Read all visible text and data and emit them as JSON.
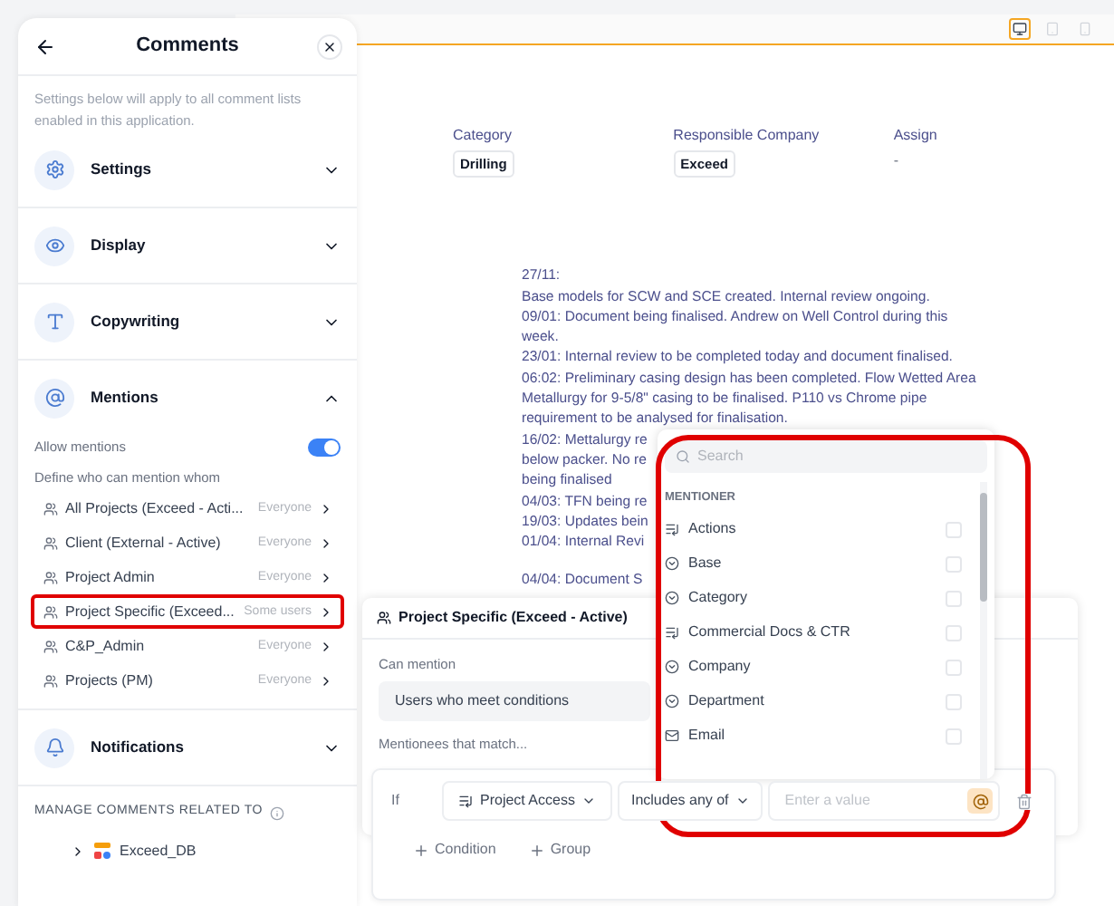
{
  "toolbar": {
    "devices": [
      {
        "kind": "desktop",
        "selected": true
      },
      {
        "kind": "tablet",
        "selected": false
      },
      {
        "kind": "phone",
        "selected": false
      }
    ]
  },
  "fields": [
    {
      "label": "Category",
      "value": "Drilling",
      "kind": "tag"
    },
    {
      "label": "Responsible Company",
      "value": "Exceed",
      "kind": "tag"
    },
    {
      "label": "Assign",
      "value": "-",
      "kind": "plain"
    }
  ],
  "notes": [
    "27/11:",
    "Base models for SCW and SCE created. Internal review ongoing.",
    "09/01: Document being finalised. Andrew on Well Control during this",
    "week.",
    "23/01: Internal review to be completed today and document finalised.",
    "06:02: Preliminary casing design has been completed. Flow Wetted Area",
    "Metallurgy for 9-5/8\" casing to be finalised. P110 vs Chrome pipe",
    "requirement to be analysed for finalisation.",
    "16/02: Mettalurgy re",
    "below packer. No re",
    "being finalised",
    "04/03: TFN being re",
    "19/03: Updates bein",
    "01/04: Internal Revi",
    "04/04: Document S"
  ],
  "comments_panel": {
    "title": "Comments",
    "description": "Settings below will apply to all comment lists enabled in this application.",
    "sections": [
      {
        "label": "Settings",
        "expanded": false
      },
      {
        "label": "Display",
        "expanded": false
      },
      {
        "label": "Copywriting",
        "expanded": false
      },
      {
        "label": "Mentions",
        "expanded": true
      },
      {
        "label": "Notifications",
        "expanded": false
      }
    ],
    "mentions": {
      "allow": {
        "label": "Allow mentions",
        "on": true
      },
      "define_label": "Define who can mention whom",
      "rules": [
        {
          "name": "All Projects (Exceed - Acti...",
          "who": "Everyone",
          "highlighted": false
        },
        {
          "name": "Client (External - Active)",
          "who": "Everyone",
          "highlighted": false
        },
        {
          "name": "Project Admin",
          "who": "Everyone",
          "highlighted": false
        },
        {
          "name": "Project Specific (Exceed...",
          "who": "Some users",
          "highlighted": true
        },
        {
          "name": "C&P_Admin",
          "who": "Everyone",
          "highlighted": false
        },
        {
          "name": "Projects (PM)",
          "who": "Everyone",
          "highlighted": false
        }
      ]
    },
    "manage_label": "MANAGE COMMENTS RELATED TO",
    "tree": [
      {
        "label": "Exceed_DB",
        "expanded": false
      }
    ]
  },
  "rule_panel": {
    "title": "Project Specific (Exceed - Active)",
    "can_mention_label": "Can mention",
    "can_mention_value": "Users who meet conditions",
    "match_label": "Mentionees that match...",
    "condition": {
      "if": "If",
      "field": "Project Access",
      "operator": "Includes any of",
      "value_placeholder": "Enter a value"
    },
    "actions": [
      "Condition",
      "Group"
    ]
  },
  "menu": {
    "highlighted": true,
    "search_placeholder": "Search",
    "header": "MENTIONER",
    "items": [
      {
        "kind": "list",
        "label": "Actions",
        "checked": false
      },
      {
        "kind": "choice",
        "label": "Base",
        "checked": false
      },
      {
        "kind": "choice",
        "label": "Category",
        "checked": false
      },
      {
        "kind": "list",
        "label": "Commercial Docs & CTR",
        "checked": false
      },
      {
        "kind": "choice",
        "label": "Company",
        "checked": false
      },
      {
        "kind": "choice",
        "label": "Department",
        "checked": false
      },
      {
        "kind": "email",
        "label": "Email",
        "checked": false
      }
    ]
  }
}
